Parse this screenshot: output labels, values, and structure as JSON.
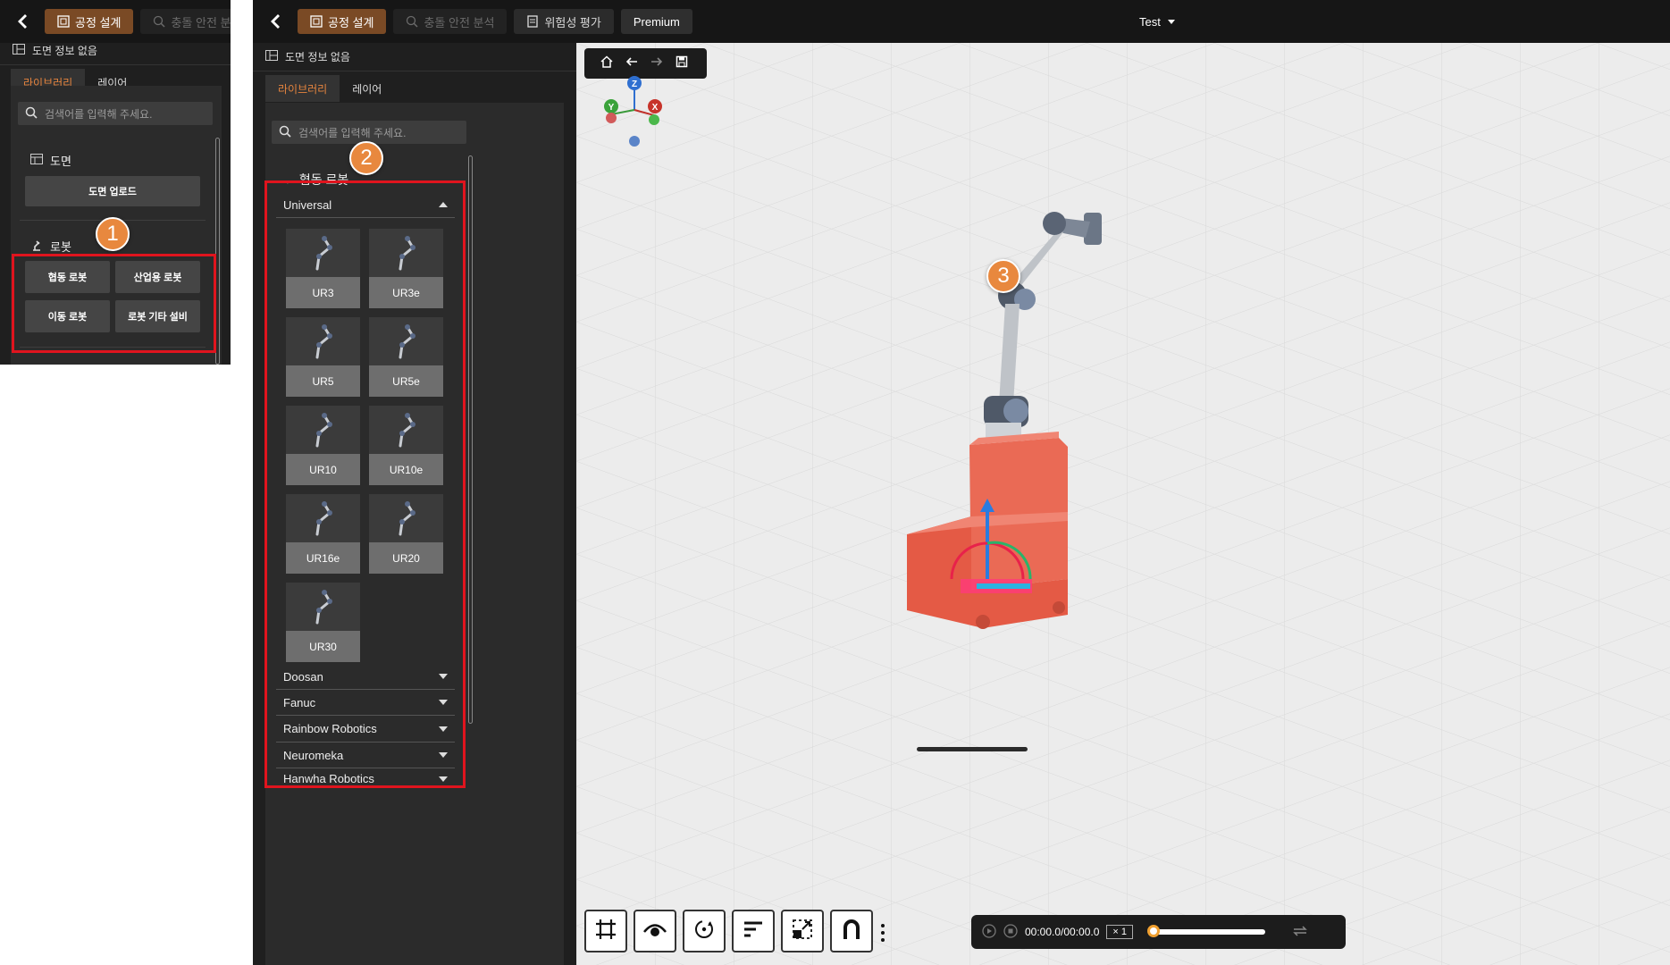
{
  "topbar": {
    "mode_design": "공정 설계",
    "mode_collision": "충돌 안전 분석",
    "mode_risk": "위험성 평가",
    "premium": "Premium",
    "project_name": "Test"
  },
  "drawing_info": "도면 정보 없음",
  "tabs": {
    "library": "라이브러리",
    "layer": "레이어"
  },
  "search": {
    "placeholder": "검색어를 입력해 주세요."
  },
  "library_root": {
    "drawing_category": "도면",
    "drawing_upload": "도면 업로드",
    "robot_category": "로봇",
    "robot_buttons": [
      "협동 로봇",
      "산업용 로봇",
      "이동 로봇",
      "로봇 기타 설비"
    ]
  },
  "library_detail": {
    "back_label": "← 협동 로봇",
    "expanded_manufacturer": "Universal",
    "models": [
      "UR3",
      "UR3e",
      "UR5",
      "UR5e",
      "UR10",
      "UR10e",
      "UR16e",
      "UR20",
      "UR30"
    ],
    "other_manufacturers": [
      "Doosan",
      "Fanuc",
      "Rainbow Robotics",
      "Neuromeka",
      "Hanwha Robotics"
    ]
  },
  "badges": [
    "1",
    "2",
    "3"
  ],
  "axes": {
    "z": "Z",
    "y": "Y",
    "x": "X"
  },
  "player": {
    "time": "00:00.0/00:00.0",
    "speed": "× 1",
    "progress": 0.0
  },
  "colors": {
    "accent": "#e6843e",
    "active_mode": "#7a4a25",
    "highlight_box": "#e0141e",
    "robot_base": "#ea6a55"
  }
}
